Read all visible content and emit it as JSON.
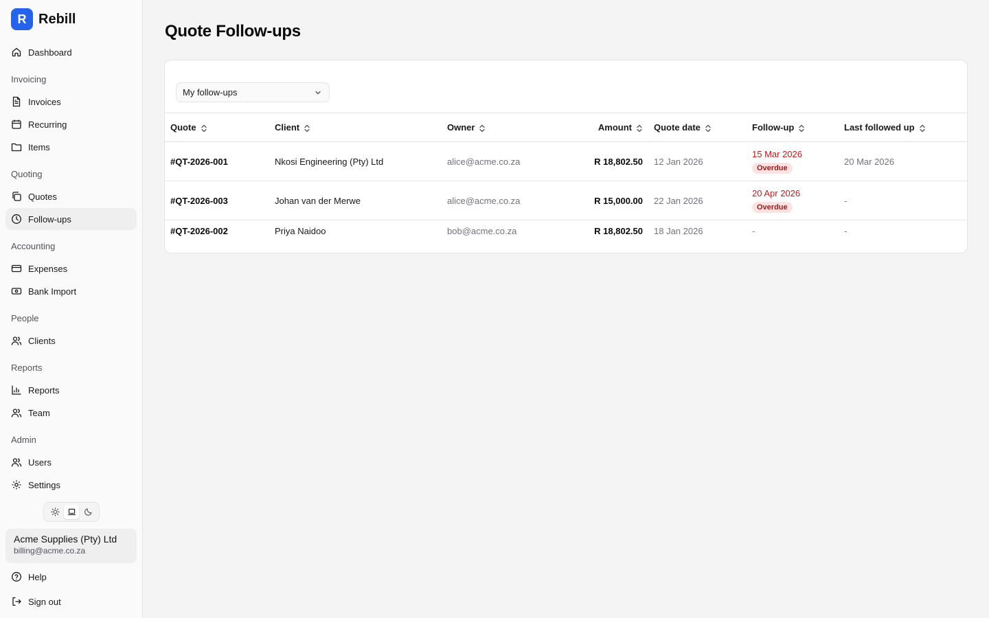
{
  "brand": {
    "logo_letter": "R",
    "name": "Rebill",
    "color": "#2563eb"
  },
  "sidebar": {
    "dashboard": "Dashboard",
    "sections": {
      "invoicing": "Invoicing",
      "quoting": "Quoting",
      "accounting": "Accounting",
      "people": "People",
      "reports": "Reports",
      "admin": "Admin"
    },
    "items": {
      "invoices": "Invoices",
      "recurring": "Recurring",
      "items": "Items",
      "quotes": "Quotes",
      "followups": "Follow-ups",
      "expenses": "Expenses",
      "bank_import": "Bank Import",
      "clients": "Clients",
      "reports": "Reports",
      "team": "Team",
      "users": "Users",
      "settings": "Settings"
    },
    "active_item": "Follow-ups",
    "theme_options": [
      "sun-icon",
      "laptop-icon",
      "moon-icon"
    ],
    "theme_selected": "laptop-icon",
    "account": {
      "name": "Acme Supplies (Pty) Ltd",
      "email": "billing@acme.co.za"
    },
    "help": "Help",
    "sign_out": "Sign out"
  },
  "main": {
    "title": "Quote Follow-ups",
    "filter": {
      "selected": "My follow-ups"
    },
    "table": {
      "columns": {
        "quote": "Quote",
        "client": "Client",
        "owner": "Owner",
        "amount": "Amount",
        "quote_date": "Quote date",
        "followup": "Follow-up",
        "last_followed": "Last followed up"
      },
      "rows": [
        {
          "quote": "#QT-2026-001",
          "client": "Nkosi Engineering (Pty) Ltd",
          "owner": "alice@acme.co.za",
          "amount": "R 18,802.50",
          "quote_date": "12 Jan 2026",
          "followup": "15 Mar 2026",
          "status": "Overdue",
          "last_followed": "20 Mar 2026"
        },
        {
          "quote": "#QT-2026-003",
          "client": "Johan van der Merwe",
          "owner": "alice@acme.co.za",
          "amount": "R 15,000.00",
          "quote_date": "22 Jan 2026",
          "followup": "20 Apr 2026",
          "status": "Overdue",
          "last_followed": "-"
        },
        {
          "quote": "#QT-2026-002",
          "client": "Priya Naidoo",
          "owner": "bob@acme.co.za",
          "amount": "R 18,802.50",
          "quote_date": "18 Jan 2026",
          "followup": "-",
          "status": "",
          "last_followed": "-"
        }
      ]
    }
  },
  "colors": {
    "overdue_text": "#b91c1c",
    "overdue_badge_bg": "#fde2e2",
    "active_nav_bg": "#efefef"
  }
}
